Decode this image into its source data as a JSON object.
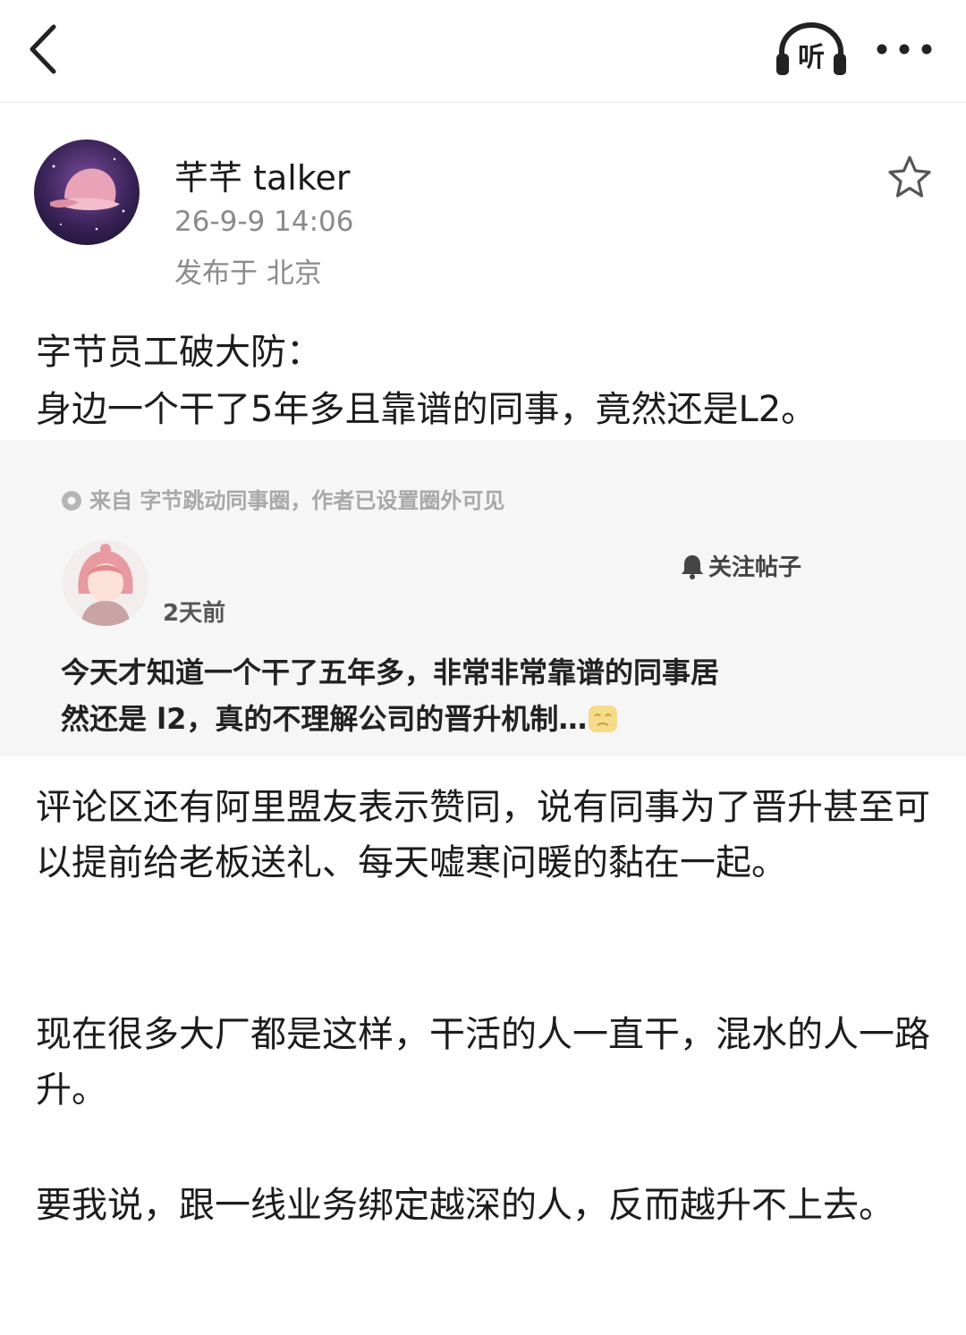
{
  "header": {
    "back_icon": "chevron-left-icon",
    "listen_label": "听",
    "more_icon": "more-horizontal-icon"
  },
  "author": {
    "name": "芊芊 talker",
    "time": "26-9-9 14:06",
    "location": "发布于 北京",
    "avatar_icon": "pink-cap-avatar"
  },
  "post": {
    "headline_line1": "字节员工破大防：",
    "headline_line2": "身边一个干了5年多且靠谱的同事，竟然还是L2。",
    "quote": {
      "source": "来自 字节跳动同事圈，作者已设置圈外可见",
      "time": "2天前",
      "follow_label": "关注帖子",
      "text_line1": "今天才知道一个干了五年多，非常非常靠谱的同事居",
      "text_line2": "然还是 l2，真的不理解公司的晋升机制…"
    },
    "paragraphs": [
      "评论区还有阿里盟友表示赞同，说有同事为了晋升甚至可以提前给老板送礼、每天嘘寒问暖的黏在一起。",
      "现在很多大厂都是这样，干活的人一直干，混水的人一路升。",
      "要我说，跟一线业务绑定越深的人，反而越升不上去。"
    ]
  },
  "colors": {
    "text": "#1c1c1c",
    "muted": "#8a8a8a",
    "card_bg": "#f6f6f6"
  }
}
